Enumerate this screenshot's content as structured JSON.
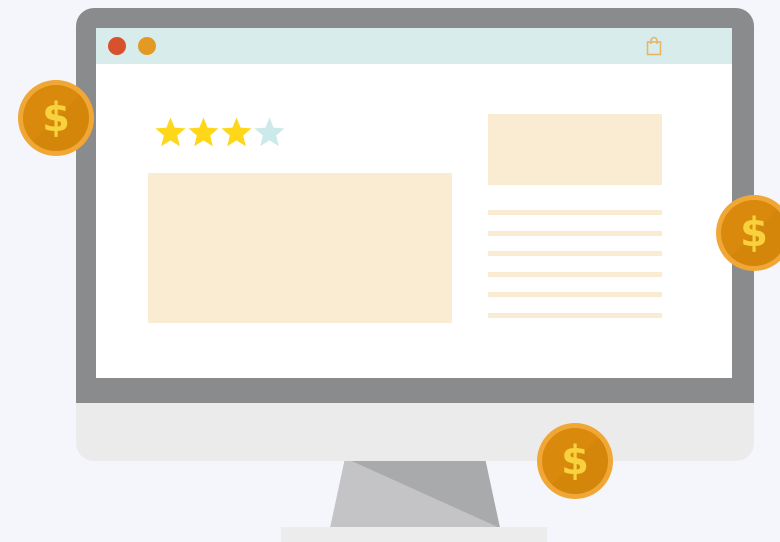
{
  "browser": {
    "window_dots": [
      {
        "name": "close",
        "color": "#d9512c"
      },
      {
        "name": "minimize",
        "color": "#e29a23"
      }
    ],
    "cart_icon": "shopping-bag-icon"
  },
  "product": {
    "rating": 3,
    "rating_max": 4,
    "star_filled_color": "#ffd71a",
    "star_empty_color": "#cdeaea",
    "placeholder_color": "#f9ecd2",
    "description_line_count": 6
  },
  "coins": [
    {
      "symbol": "$"
    },
    {
      "symbol": "$"
    },
    {
      "symbol": "$"
    }
  ],
  "colors": {
    "background": "#f4f6fc",
    "bezel": "#8a8b8d",
    "chin": "#ebebeb",
    "titlebar": "#d9ecec",
    "coin_outer": "#f0a736",
    "coin_inner": "#d98a0c",
    "coin_symbol": "#f8d23c"
  }
}
